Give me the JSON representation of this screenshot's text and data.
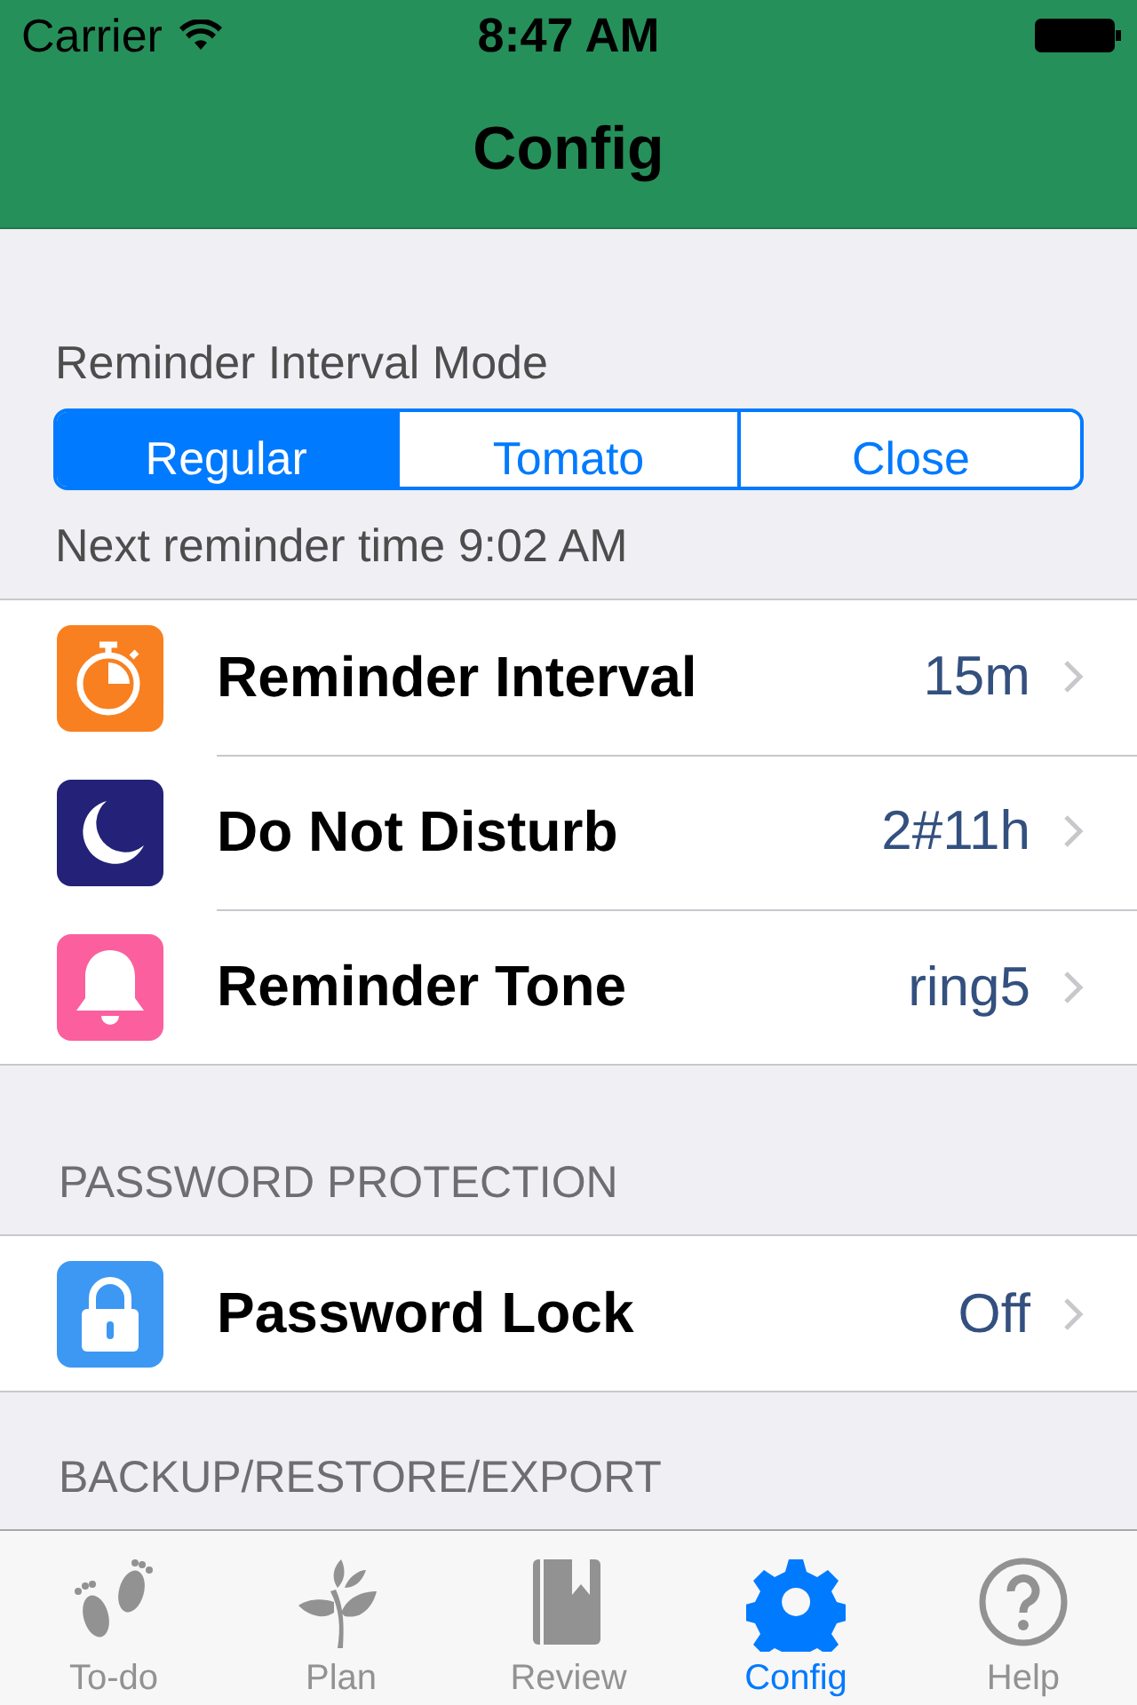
{
  "status_bar": {
    "carrier": "Carrier",
    "time": "8:47 AM"
  },
  "nav": {
    "title": "Config"
  },
  "mode": {
    "label": "Reminder Interval Mode",
    "segments": [
      {
        "label": "Regular",
        "selected": true
      },
      {
        "label": "Tomato",
        "selected": false
      },
      {
        "label": "Close",
        "selected": false
      }
    ],
    "note": "Next reminder time 9:02 AM"
  },
  "rows": [
    {
      "kind": "stopwatch",
      "color": "#f98020",
      "label": "Reminder Interval",
      "value": "15m"
    },
    {
      "kind": "moon",
      "color": "#232278",
      "label": "Do Not Disturb",
      "value": "2#11h"
    },
    {
      "kind": "bell",
      "color": "#fc5f9d",
      "label": "Reminder Tone",
      "value": "ring5"
    }
  ],
  "password": {
    "header": "PASSWORD PROTECTION",
    "rows": [
      {
        "kind": "lock",
        "color": "#3d98f3",
        "label": "Password Lock",
        "value": "Off"
      }
    ]
  },
  "backup": {
    "header": "BACKUP/RESTORE/EXPORT"
  },
  "tabs": [
    {
      "kind": "feet",
      "label": "To-do",
      "selected": false
    },
    {
      "kind": "plant",
      "label": "Plan",
      "selected": false
    },
    {
      "kind": "book",
      "label": "Review",
      "selected": false
    },
    {
      "kind": "gear",
      "label": "Config",
      "selected": true
    },
    {
      "kind": "help",
      "label": "Help",
      "selected": false
    }
  ]
}
